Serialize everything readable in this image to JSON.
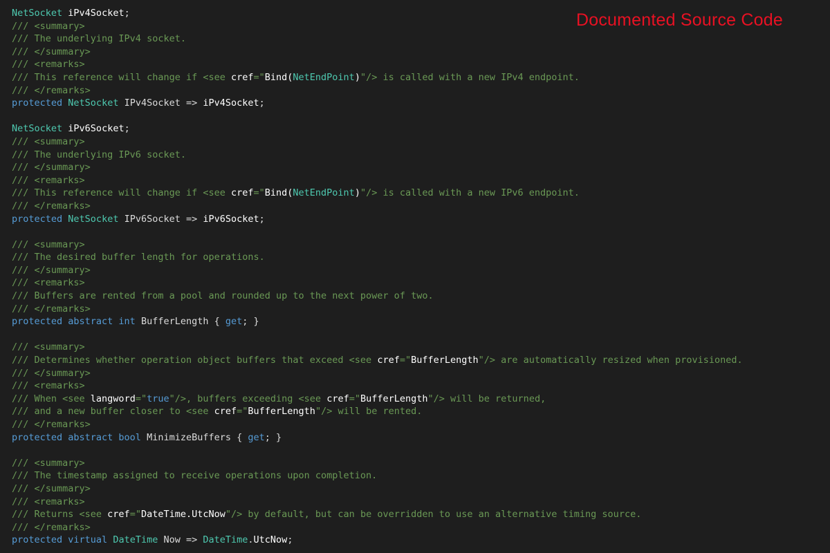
{
  "banner": {
    "text": "Documented Source Code"
  },
  "colors": {
    "background": "#1e1e1e",
    "comment": "#6a9955",
    "keyword": "#569cd6",
    "type": "#4ec9b0",
    "text": "#d4d4d4",
    "banner": "#e81123"
  },
  "code": {
    "lines": [
      [
        {
          "cls": "t",
          "text": "NetSocket"
        },
        {
          "cls": "i",
          "text": " "
        },
        {
          "cls": "w",
          "text": "iPv4Socket"
        },
        {
          "cls": "i",
          "text": ";"
        }
      ],
      [
        {
          "cls": "c",
          "text": "/// <summary>"
        }
      ],
      [
        {
          "cls": "c",
          "text": "/// The underlying IPv4 socket."
        }
      ],
      [
        {
          "cls": "c",
          "text": "/// </summary>"
        }
      ],
      [
        {
          "cls": "c",
          "text": "/// <remarks>"
        }
      ],
      [
        {
          "cls": "c",
          "text": "/// This reference will change if <see "
        },
        {
          "cls": "w",
          "text": "cref"
        },
        {
          "cls": "c",
          "text": "=\""
        },
        {
          "cls": "w",
          "text": "Bind("
        },
        {
          "cls": "t",
          "text": "NetEndPoint"
        },
        {
          "cls": "w",
          "text": ")"
        },
        {
          "cls": "c",
          "text": "\"/> is called with a new IPv4 endpoint."
        }
      ],
      [
        {
          "cls": "c",
          "text": "/// </remarks>"
        }
      ],
      [
        {
          "cls": "k",
          "text": "protected"
        },
        {
          "cls": "i",
          "text": " "
        },
        {
          "cls": "t",
          "text": "NetSocket"
        },
        {
          "cls": "i",
          "text": " IPv4Socket => "
        },
        {
          "cls": "w",
          "text": "iPv4Socket"
        },
        {
          "cls": "i",
          "text": ";"
        }
      ],
      [
        {
          "cls": "i",
          "text": ""
        }
      ],
      [
        {
          "cls": "t",
          "text": "NetSocket"
        },
        {
          "cls": "i",
          "text": " "
        },
        {
          "cls": "w",
          "text": "iPv6Socket"
        },
        {
          "cls": "i",
          "text": ";"
        }
      ],
      [
        {
          "cls": "c",
          "text": "/// <summary>"
        }
      ],
      [
        {
          "cls": "c",
          "text": "/// The underlying IPv6 socket."
        }
      ],
      [
        {
          "cls": "c",
          "text": "/// </summary>"
        }
      ],
      [
        {
          "cls": "c",
          "text": "/// <remarks>"
        }
      ],
      [
        {
          "cls": "c",
          "text": "/// This reference will change if <see "
        },
        {
          "cls": "w",
          "text": "cref"
        },
        {
          "cls": "c",
          "text": "=\""
        },
        {
          "cls": "w",
          "text": "Bind("
        },
        {
          "cls": "t",
          "text": "NetEndPoint"
        },
        {
          "cls": "w",
          "text": ")"
        },
        {
          "cls": "c",
          "text": "\"/> is called with a new IPv6 endpoint."
        }
      ],
      [
        {
          "cls": "c",
          "text": "/// </remarks>"
        }
      ],
      [
        {
          "cls": "k",
          "text": "protected"
        },
        {
          "cls": "i",
          "text": " "
        },
        {
          "cls": "t",
          "text": "NetSocket"
        },
        {
          "cls": "i",
          "text": " IPv6Socket => "
        },
        {
          "cls": "w",
          "text": "iPv6Socket"
        },
        {
          "cls": "i",
          "text": ";"
        }
      ],
      [
        {
          "cls": "i",
          "text": ""
        }
      ],
      [
        {
          "cls": "c",
          "text": "/// <summary>"
        }
      ],
      [
        {
          "cls": "c",
          "text": "/// The desired buffer length for operations."
        }
      ],
      [
        {
          "cls": "c",
          "text": "/// </summary>"
        }
      ],
      [
        {
          "cls": "c",
          "text": "/// <remarks>"
        }
      ],
      [
        {
          "cls": "c",
          "text": "/// Buffers are rented from a pool and rounded up to the next power of two."
        }
      ],
      [
        {
          "cls": "c",
          "text": "/// </remarks>"
        }
      ],
      [
        {
          "cls": "k",
          "text": "protected abstract int"
        },
        {
          "cls": "i",
          "text": " BufferLength { "
        },
        {
          "cls": "k",
          "text": "get"
        },
        {
          "cls": "i",
          "text": "; }"
        }
      ],
      [
        {
          "cls": "i",
          "text": ""
        }
      ],
      [
        {
          "cls": "c",
          "text": "/// <summary>"
        }
      ],
      [
        {
          "cls": "c",
          "text": "/// Determines whether operation object buffers that exceed <see "
        },
        {
          "cls": "w",
          "text": "cref"
        },
        {
          "cls": "c",
          "text": "=\""
        },
        {
          "cls": "w",
          "text": "BufferLength"
        },
        {
          "cls": "c",
          "text": "\"/> are automatically resized when provisioned."
        }
      ],
      [
        {
          "cls": "c",
          "text": "/// </summary>"
        }
      ],
      [
        {
          "cls": "c",
          "text": "/// <remarks>"
        }
      ],
      [
        {
          "cls": "c",
          "text": "/// When <see "
        },
        {
          "cls": "w",
          "text": "langword"
        },
        {
          "cls": "c",
          "text": "=\""
        },
        {
          "cls": "k",
          "text": "true"
        },
        {
          "cls": "c",
          "text": "\"/>, buffers exceeding <see "
        },
        {
          "cls": "w",
          "text": "cref"
        },
        {
          "cls": "c",
          "text": "=\""
        },
        {
          "cls": "w",
          "text": "BufferLength"
        },
        {
          "cls": "c",
          "text": "\"/> will be returned,"
        }
      ],
      [
        {
          "cls": "c",
          "text": "/// and a new buffer closer to <see "
        },
        {
          "cls": "w",
          "text": "cref"
        },
        {
          "cls": "c",
          "text": "=\""
        },
        {
          "cls": "w",
          "text": "BufferLength"
        },
        {
          "cls": "c",
          "text": "\"/> will be rented."
        }
      ],
      [
        {
          "cls": "c",
          "text": "/// </remarks>"
        }
      ],
      [
        {
          "cls": "k",
          "text": "protected abstract bool"
        },
        {
          "cls": "i",
          "text": " MinimizeBuffers { "
        },
        {
          "cls": "k",
          "text": "get"
        },
        {
          "cls": "i",
          "text": "; }"
        }
      ],
      [
        {
          "cls": "i",
          "text": ""
        }
      ],
      [
        {
          "cls": "c",
          "text": "/// <summary>"
        }
      ],
      [
        {
          "cls": "c",
          "text": "/// The timestamp assigned to receive operations upon completion."
        }
      ],
      [
        {
          "cls": "c",
          "text": "/// </summary>"
        }
      ],
      [
        {
          "cls": "c",
          "text": "/// <remarks>"
        }
      ],
      [
        {
          "cls": "c",
          "text": "/// Returns <see "
        },
        {
          "cls": "w",
          "text": "cref"
        },
        {
          "cls": "c",
          "text": "=\""
        },
        {
          "cls": "w",
          "text": "DateTime.UtcNow"
        },
        {
          "cls": "c",
          "text": "\"/> by default, but can be overridden to use an alternative timing source."
        }
      ],
      [
        {
          "cls": "c",
          "text": "/// </remarks>"
        }
      ],
      [
        {
          "cls": "k",
          "text": "protected virtual"
        },
        {
          "cls": "i",
          "text": " "
        },
        {
          "cls": "t",
          "text": "DateTime"
        },
        {
          "cls": "i",
          "text": " Now => "
        },
        {
          "cls": "t",
          "text": "DateTime"
        },
        {
          "cls": "i",
          "text": "."
        },
        {
          "cls": "w",
          "text": "UtcNow"
        },
        {
          "cls": "i",
          "text": ";"
        }
      ]
    ]
  }
}
